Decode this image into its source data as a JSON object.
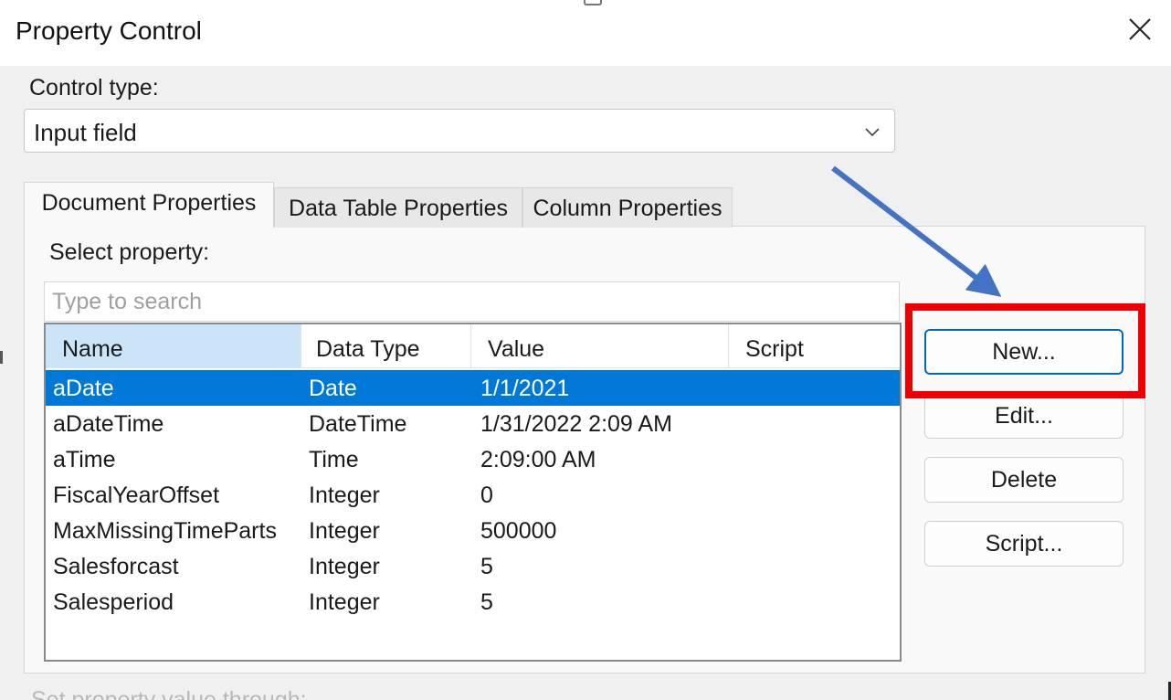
{
  "window": {
    "title": "Property Control"
  },
  "control_type": {
    "label": "Control type:",
    "selected": "Input field"
  },
  "tabs": [
    {
      "label": "Document Properties",
      "active": true
    },
    {
      "label": "Data Table Properties",
      "active": false
    },
    {
      "label": "Column Properties",
      "active": false
    }
  ],
  "select_property": {
    "label": "Select property:",
    "search_placeholder": "Type to search"
  },
  "table": {
    "columns": [
      "Name",
      "Data Type",
      "Value",
      "Script"
    ],
    "rows": [
      {
        "name": "aDate",
        "type": "Date",
        "value": "1/1/2021",
        "script": "",
        "selected": true
      },
      {
        "name": "aDateTime",
        "type": "DateTime",
        "value": "1/31/2022 2:09 AM",
        "script": "",
        "selected": false
      },
      {
        "name": "aTime",
        "type": "Time",
        "value": "2:09:00 AM",
        "script": "",
        "selected": false
      },
      {
        "name": "FiscalYearOffset",
        "type": "Integer",
        "value": "0",
        "script": "",
        "selected": false
      },
      {
        "name": "MaxMissingTimeParts",
        "type": "Integer",
        "value": "500000",
        "script": "",
        "selected": false
      },
      {
        "name": "Salesforcast",
        "type": "Integer",
        "value": "5",
        "script": "",
        "selected": false
      },
      {
        "name": "Salesperiod",
        "type": "Integer",
        "value": "5",
        "script": "",
        "selected": false
      }
    ]
  },
  "buttons": {
    "new": "New...",
    "edit": "Edit...",
    "delete": "Delete",
    "script": "Script..."
  },
  "footer": {
    "partial_text": "Set property value through:"
  },
  "colors": {
    "selection": "#0078d7",
    "header_highlight": "#cce4f7",
    "annotation_box": "#ee0000",
    "annotation_arrow": "#4472c4"
  },
  "icons": [
    "close-icon",
    "chevron-down-icon",
    "annotation-arrow"
  ]
}
